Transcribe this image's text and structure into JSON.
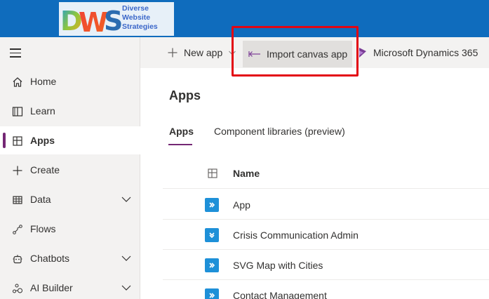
{
  "colors": {
    "brand": "#0f6cbd",
    "accent": "#742774",
    "highlight": "#e30613",
    "app_icon": "#1e90d8"
  },
  "logo": {
    "mark": "DWS",
    "lines": [
      "Diverse",
      "Website",
      "Strategies"
    ]
  },
  "nav": {
    "menu_icon": "hamburger-icon",
    "items": [
      {
        "label": "Home",
        "icon": "home-icon",
        "expandable": false,
        "active": false
      },
      {
        "label": "Learn",
        "icon": "book-icon",
        "expandable": false,
        "active": false
      },
      {
        "label": "Apps",
        "icon": "apps-icon",
        "expandable": false,
        "active": true
      },
      {
        "label": "Create",
        "icon": "plus-icon",
        "expandable": false,
        "active": false
      },
      {
        "label": "Data",
        "icon": "table-icon",
        "expandable": true,
        "active": false
      },
      {
        "label": "Flows",
        "icon": "flow-icon",
        "expandable": false,
        "active": false
      },
      {
        "label": "Chatbots",
        "icon": "bot-icon",
        "expandable": true,
        "active": false
      },
      {
        "label": "AI Builder",
        "icon": "ai-builder-icon",
        "expandable": true,
        "active": false
      }
    ]
  },
  "commandbar": {
    "new_app": "New app",
    "import_canvas": "Import canvas app",
    "dynamics": "Microsoft Dynamics 365"
  },
  "main": {
    "title": "Apps",
    "tabs": [
      {
        "label": "Apps",
        "active": true
      },
      {
        "label": "Component libraries (preview)",
        "active": false
      }
    ],
    "table": {
      "column_name": "Name",
      "rows": [
        {
          "name": "App",
          "icon": "canvas-app-icon"
        },
        {
          "name": "Crisis Communication Admin",
          "icon": "model-app-icon"
        },
        {
          "name": "SVG Map with Cities",
          "icon": "canvas-app-icon"
        },
        {
          "name": "Contact Management",
          "icon": "canvas-app-icon"
        }
      ]
    }
  }
}
